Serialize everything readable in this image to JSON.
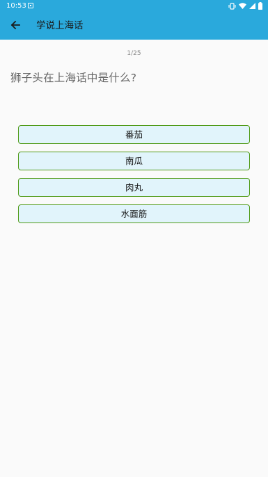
{
  "status_bar": {
    "time": "10:53",
    "icons": [
      "notification-icon",
      "vibrate-icon",
      "wifi-icon",
      "signal-icon",
      "battery-icon"
    ]
  },
  "app_bar": {
    "title": "学说上海话",
    "color": "#2aa9dc"
  },
  "quiz": {
    "progress": "1/25",
    "question": "狮子头在上海话中是什么?",
    "answers": [
      "番茄",
      "南瓜",
      "肉丸",
      "水面筋"
    ],
    "answer_bg": "#e1f4fb",
    "answer_border": "#4f9a16"
  }
}
